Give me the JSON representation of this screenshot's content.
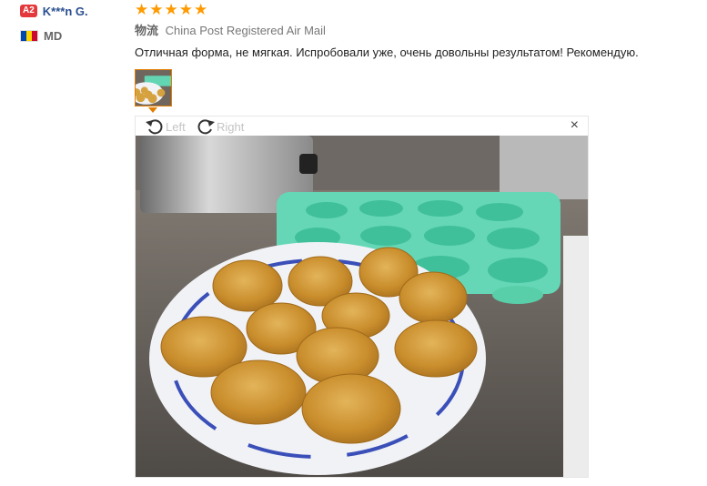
{
  "reviewer": {
    "level_badge": "A2",
    "name": "K***n G.",
    "country_code": "MD"
  },
  "review": {
    "stars": "★★★★★",
    "rating": 5,
    "shipping_label": "物流",
    "shipping_method": "China Post Registered Air Mail",
    "text": "Отличная форма, не мягкая. Испробовали уже, очень довольны результатом! Рекомендую."
  },
  "viewer": {
    "rotate_left_label": "Left",
    "rotate_right_label": "Right",
    "close_label": "×"
  },
  "colors": {
    "accent_orange": "#e27d00",
    "star": "#ff9a00",
    "name_blue": "#2a4e8f",
    "badge_red": "#e4393c"
  }
}
